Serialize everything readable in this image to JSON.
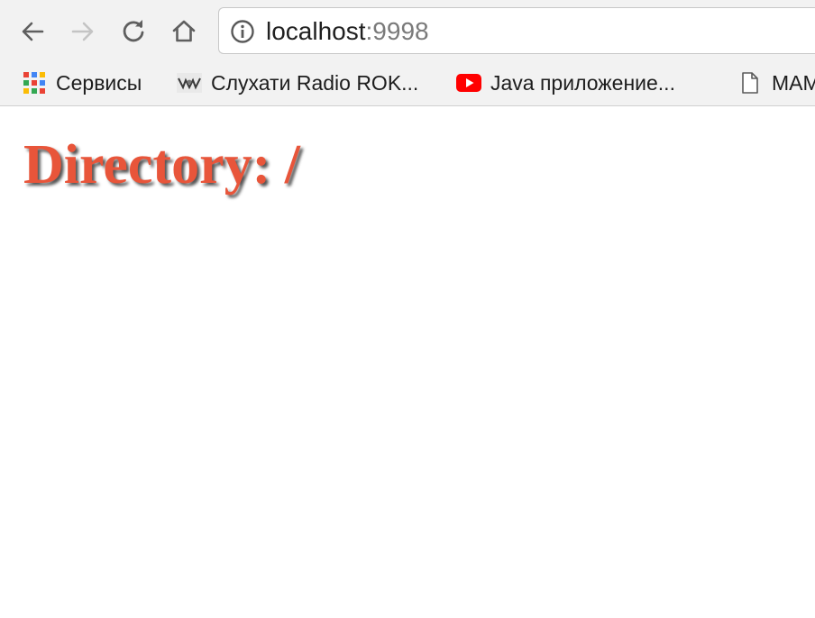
{
  "browser": {
    "address_bar": {
      "host": "localhost",
      "port": ":9998"
    },
    "bookmarks": [
      {
        "label": "Сервисы",
        "icon": "apps-grid-icon"
      },
      {
        "label": "Слухати Radio ROK...",
        "icon": "radio-rok-favicon"
      },
      {
        "label": "Java приложение...",
        "icon": "youtube-icon"
      },
      {
        "label": "МАМ",
        "icon": "page-icon"
      }
    ],
    "colors": {
      "toolbar_bg": "#f2f2f2",
      "youtube_red": "#ff0000"
    }
  },
  "page": {
    "heading": "Directory: /",
    "heading_color": "#e8553a"
  }
}
